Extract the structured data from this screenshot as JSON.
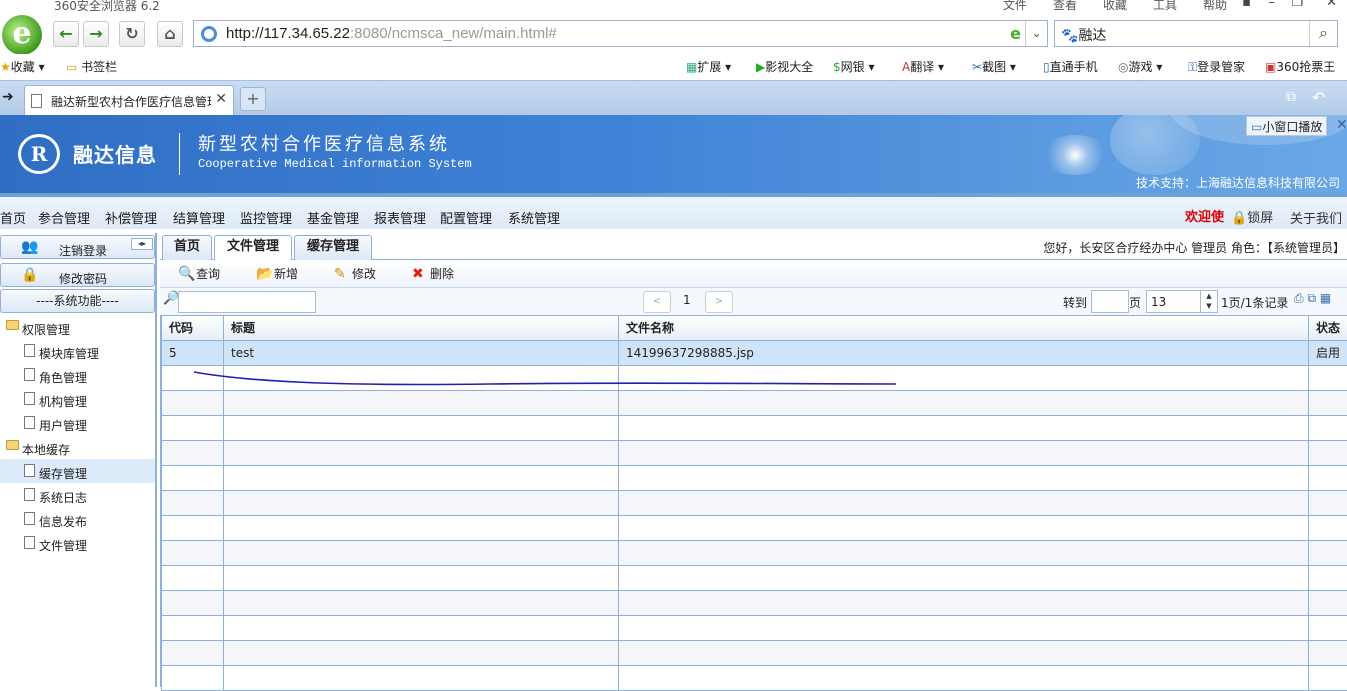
{
  "browser": {
    "title": "360安全浏览器 6.2",
    "menus": [
      "文件",
      "查看",
      "收藏",
      "工具",
      "帮助"
    ],
    "url_host": "http://117.34.65.22",
    "url_rest": ":8080/ncmsca_new/main.html#",
    "search_value": "融达",
    "bookmarks_left": [
      "收藏",
      "书签栏"
    ],
    "bookmarks_right": [
      "扩展",
      "影视大全",
      "网银",
      "翻译",
      "截图",
      "直通手机",
      "游戏",
      "登录管家",
      "360抢票王"
    ],
    "tab_title": "融达新型农村合作医疗信息管理",
    "new_tab": "+"
  },
  "header": {
    "brand": "融达信息",
    "system_title": "新型农村合作医疗信息系统",
    "system_subtitle": "Cooperative Medical information System",
    "support": "技术支持：上海融达信息科技有限公司",
    "mini_play": "小窗口播放"
  },
  "menu": {
    "items": [
      "首页",
      "参合管理",
      "补偿管理",
      "结算管理",
      "监控管理",
      "基金管理",
      "报表管理",
      "配置管理",
      "系统管理"
    ],
    "welcome": "欢迎使",
    "lock": "锁屏",
    "about": "关于我们"
  },
  "sidebar": {
    "logout": "注销登录",
    "change_password": "修改密码",
    "section": "----系统功能----",
    "tree": [
      {
        "label": "权限管理",
        "type": "folder"
      },
      {
        "label": "模块库管理",
        "type": "doc"
      },
      {
        "label": "角色管理",
        "type": "doc"
      },
      {
        "label": "机构管理",
        "type": "doc"
      },
      {
        "label": "用户管理",
        "type": "doc"
      },
      {
        "label": "本地缓存",
        "type": "folder"
      },
      {
        "label": "缓存管理",
        "type": "doc",
        "selected": true
      },
      {
        "label": "系统日志",
        "type": "doc"
      },
      {
        "label": "信息发布",
        "type": "doc"
      },
      {
        "label": "文件管理",
        "type": "doc"
      }
    ]
  },
  "content": {
    "tabs": [
      "首页",
      "文件管理",
      "缓存管理"
    ],
    "active_tab": "文件管理",
    "greeting": "您好，长安区合疗经办中心  管理员   角色：【系统管理员】",
    "toolbar": {
      "query": "查询",
      "add": "新增",
      "edit": "修改",
      "delete": "删除"
    },
    "pager": {
      "prev": "<",
      "current": "1",
      "next": ">",
      "goto": "转到",
      "page": "页",
      "page_size": "13",
      "info": "1页/1条记录"
    },
    "columns": [
      "代码",
      "标题",
      "文件名称",
      "状态"
    ],
    "rows": [
      {
        "code": "5",
        "title": "test",
        "filename": "14199637298885.jsp",
        "status": "启用"
      }
    ]
  },
  "colors": {
    "banner": "#3f82d6",
    "selected_row": "#cfe4f8",
    "welcome": "#dd0000",
    "border": "#8fb1d9"
  }
}
